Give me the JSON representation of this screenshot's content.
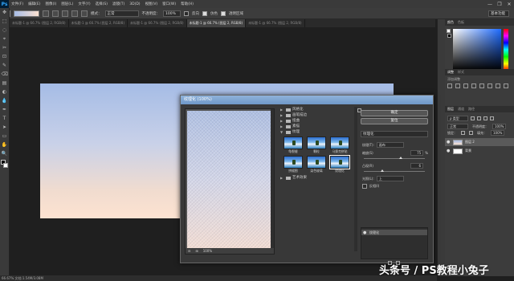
{
  "app": {
    "logo": "Ps"
  },
  "menu": [
    "文件(F)",
    "编辑(E)",
    "图像(I)",
    "图层(L)",
    "文字(Y)",
    "选择(S)",
    "滤镜(T)",
    "3D(D)",
    "视图(V)",
    "窗口(W)",
    "帮助(H)"
  ],
  "window_controls": [
    "—",
    "❐",
    "✕"
  ],
  "options": {
    "mode_label": "模式：",
    "mode_value": "正常",
    "opacity_label": "不透明度：",
    "opacity_value": "100%",
    "reverse": "反向",
    "dither": "仿色",
    "transparency": "透明区域",
    "workspace": "基本功能"
  },
  "tabs": [
    {
      "label": "未标题-1 @ 66.7% (图层 2, RGB/8)",
      "active": false
    },
    {
      "label": "未标题-1 @ 66.7% (图层 2, RGB/8)",
      "active": false
    },
    {
      "label": "未标题-1 @ 66.7% (图层 2, RGB/8)",
      "active": false
    },
    {
      "label": "未标题-1 @ 66.7% (图层 2, RGB/8)",
      "active": true
    },
    {
      "label": "未标题-1 @ 66.7% (图层 2, RGB/8)",
      "active": false
    }
  ],
  "tools": [
    "✥",
    "⬚",
    "◌",
    "⌖",
    "✂",
    "⊡",
    "✎",
    "⌫",
    "▤",
    "◐",
    "💧",
    "✒",
    "T",
    "➤",
    "▭",
    "✋",
    "🔍"
  ],
  "status": "66.67%  文档:1.54M/3.08M",
  "dialog": {
    "title": "纹理化 (100%)",
    "zoom": "100%",
    "categories": [
      {
        "label": "风格化",
        "open": false
      },
      {
        "label": "画笔描边",
        "open": false
      },
      {
        "label": "扭曲",
        "open": false
      },
      {
        "label": "素描",
        "open": false
      },
      {
        "label": "纹理",
        "open": true
      }
    ],
    "thumbs": [
      {
        "label": "龟裂缝",
        "selected": false
      },
      {
        "label": "颗粒",
        "selected": false
      },
      {
        "label": "马赛克拼贴",
        "selected": false
      },
      {
        "label": "拼缀图",
        "selected": false
      },
      {
        "label": "染色玻璃",
        "selected": false
      },
      {
        "label": "纹理化",
        "selected": true
      }
    ],
    "last_category": {
      "label": "艺术效果",
      "open": false
    },
    "ok": "确定",
    "reset": "复位",
    "filter_select": "纹理化",
    "texture_label": "纹理(T):",
    "texture_value": "画布",
    "scale_label": "缩放(S)",
    "scale_value": "75",
    "scale_unit": "%",
    "scale_level": 0.6,
    "relief_label": "凸现(R)",
    "relief_value": "6",
    "relief_level": 0.3,
    "light_label": "光照(L):",
    "light_value": "上",
    "invert_label": "反相(I)",
    "layer_item": "纹理化"
  },
  "panels": {
    "color_tabs": [
      "颜色",
      "色板"
    ],
    "adjust_tabs": [
      "调整",
      "样式"
    ],
    "adjust_label": "添加调整",
    "layers_tabs": [
      "图层",
      "通道",
      "路径"
    ],
    "filter_label": "ρ 类型",
    "blend_mode": "正常",
    "opacity_label": "不透明度：",
    "opacity_value": "100%",
    "lock_label": "锁定：",
    "fill_label": "填充：",
    "fill_value": "100%",
    "layers": [
      {
        "name": "图层 2",
        "selected": true
      },
      {
        "name": "背景",
        "selected": false
      }
    ]
  },
  "watermark": "头条号 / PS教程小兔子"
}
